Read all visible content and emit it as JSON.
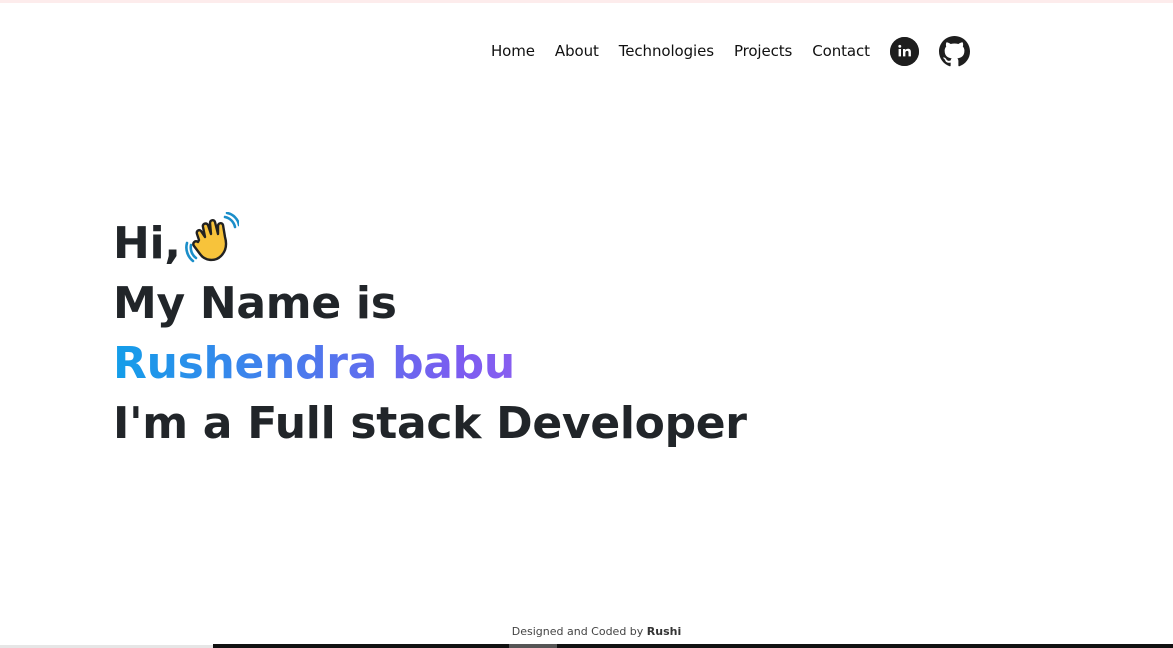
{
  "nav": {
    "items": [
      {
        "label": "Home"
      },
      {
        "label": "About"
      },
      {
        "label": "Technologies"
      },
      {
        "label": "Projects"
      },
      {
        "label": "Contact"
      }
    ],
    "social": {
      "linkedin_icon": "linkedin-icon",
      "linkedin_text": "in",
      "github_icon": "github-icon"
    }
  },
  "hero": {
    "greeting": "Hi,",
    "wave_icon": "waving-hand-icon",
    "intro": "My Name is",
    "name": "Rushendra babu",
    "role": "I'm a Full stack Developer"
  },
  "footer": {
    "prefix": "Designed and Coded by ",
    "author": "Rushi"
  },
  "colors": {
    "text": "#212529",
    "name_gradient_start": "#139ee9",
    "name_gradient_mid": "#7c5cf0",
    "name_gradient_end": "#bb6bf2",
    "icon_dark": "#1e1e1e"
  }
}
